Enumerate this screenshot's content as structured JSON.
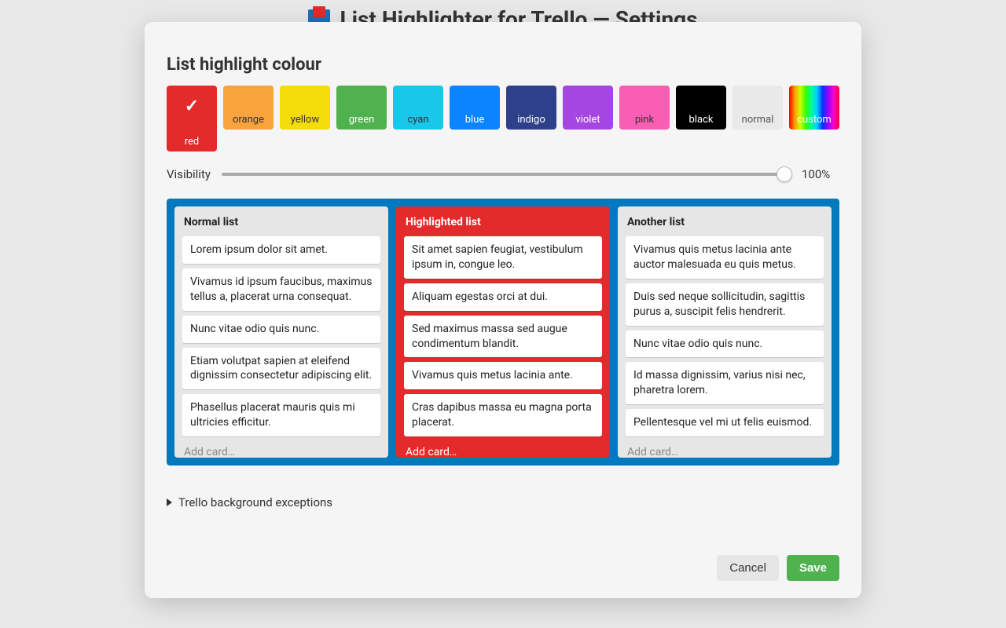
{
  "page": {
    "title": "List Highlighter for Trello — Settings"
  },
  "section": {
    "title": "List highlight colour"
  },
  "colors": {
    "selected_index": 0,
    "items": [
      {
        "label": "red",
        "class": "swatch-red"
      },
      {
        "label": "orange",
        "class": "swatch-orange"
      },
      {
        "label": "yellow",
        "class": "swatch-yellow"
      },
      {
        "label": "green",
        "class": "swatch-green"
      },
      {
        "label": "cyan",
        "class": "swatch-cyan"
      },
      {
        "label": "blue",
        "class": "swatch-blue"
      },
      {
        "label": "indigo",
        "class": "swatch-indigo"
      },
      {
        "label": "violet",
        "class": "swatch-violet"
      },
      {
        "label": "pink",
        "class": "swatch-pink"
      },
      {
        "label": "black",
        "class": "swatch-black"
      },
      {
        "label": "normal",
        "class": "swatch-normal"
      },
      {
        "label": "custom",
        "class": "swatch-custom"
      }
    ]
  },
  "visibility": {
    "label": "Visibility",
    "value_label": "100%",
    "value_pct": 100
  },
  "board": {
    "lists": [
      {
        "title": "Normal list",
        "highlighted": false,
        "cards": [
          "Lorem ipsum dolor sit amet.",
          "Vivamus id ipsum faucibus, maximus tellus a, placerat urna consequat.",
          "Nunc vitae odio quis nunc.",
          "Etiam volutpat sapien at eleifend dignissim consectetur adipiscing elit.",
          "Phasellus placerat mauris quis mi ultricies efficitur."
        ],
        "add_label": "Add card…"
      },
      {
        "title": "Highlighted list",
        "highlighted": true,
        "cards": [
          "Sit amet sapien feugiat, vestibulum ipsum in, congue leo.",
          "Aliquam egestas orci at dui.",
          "Sed maximus massa sed augue condimentum blandit.",
          "Vivamus quis metus lacinia ante.",
          "Cras dapibus massa eu magna porta placerat."
        ],
        "add_label": "Add card…"
      },
      {
        "title": "Another list",
        "highlighted": false,
        "cards": [
          "Vivamus quis metus lacinia ante auctor malesuada eu quis metus.",
          "Duis sed neque sollicitudin, sagittis purus a, suscipit felis hendrerit.",
          "Nunc vitae odio quis nunc.",
          "Id massa dignissim, varius nisi nec, pharetra lorem.",
          "Pellentesque vel mi ut felis euismod."
        ],
        "add_label": "Add card…"
      }
    ]
  },
  "exceptions": {
    "label": "Trello background exceptions",
    "expanded": false
  },
  "buttons": {
    "cancel": "Cancel",
    "save": "Save"
  }
}
